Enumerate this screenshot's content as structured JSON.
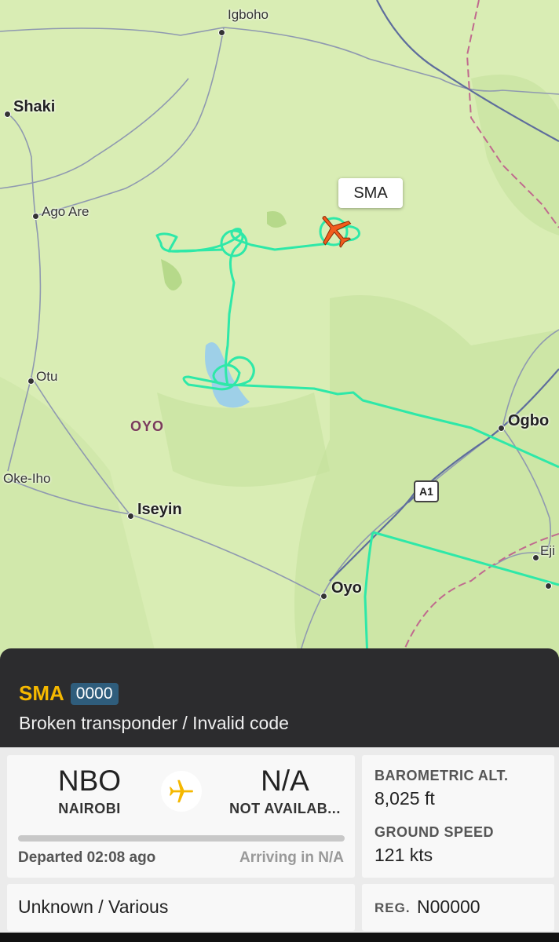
{
  "map": {
    "places": {
      "igboho": "Igboho",
      "shaki": "Shaki",
      "ago_are": "Ago Are",
      "otu": "Otu",
      "oke_iho": "Oke-Iho",
      "iseyin": "Iseyin",
      "oyo": "Oyo",
      "ogbo": "Ogbo",
      "eji": "Eji",
      "region": "OYO"
    },
    "road_shield": "A1",
    "aircraft_callout": "SMA",
    "track_color": "#2ee8a8",
    "aircraft_color": "#f25c1c"
  },
  "flight": {
    "callsign": "SMA",
    "squawk": "0000",
    "squawk_description": "Broken transponder / Invalid code",
    "origin_code": "NBO",
    "origin_city": "NAIROBI",
    "destination_code": "N/A",
    "destination_city": "NOT AVAILAB...",
    "departed_text": "Departed 02:08 ago",
    "arriving_text": "Arriving in N/A",
    "progress": 0,
    "baro_alt_label": "BAROMETRIC ALT.",
    "baro_alt_value": "8,025 ft",
    "ground_speed_label": "GROUND SPEED",
    "ground_speed_value": "121 kts",
    "aircraft_type": "Unknown / Various",
    "reg_label": "REG.",
    "reg_value": "N00000"
  },
  "icons": {
    "route_plane": "airplane-icon",
    "map_aircraft": "aircraft-marker-icon"
  }
}
